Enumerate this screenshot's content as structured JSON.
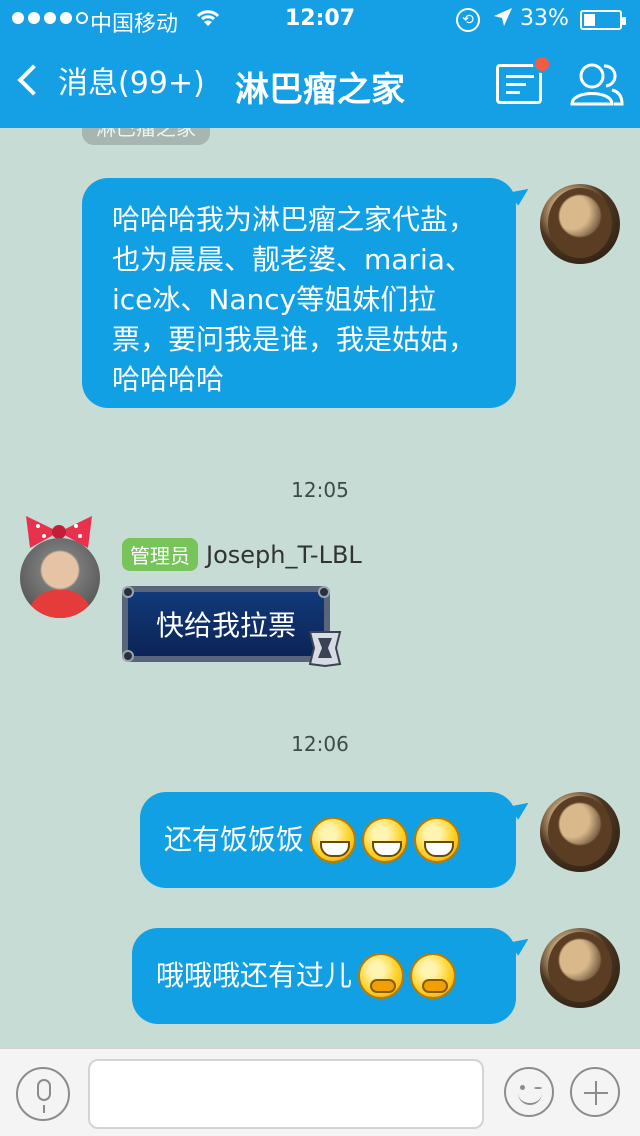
{
  "status_bar": {
    "carrier": "中国移动",
    "time": "12:07",
    "battery_percent_text": "33%",
    "battery_level": 0.33
  },
  "nav": {
    "back_label": "消息(99+)",
    "title": "淋巴瘤之家"
  },
  "chat": {
    "clipped_tag": "淋巴瘤之家",
    "timestamps": [
      "12:05",
      "12:06"
    ],
    "messages": [
      {
        "sender": "me",
        "text": "哈哈哈我为淋巴瘤之家代盐，也为晨晨、靓老婆、maria、ice冰、Nancy等姐妹们拉票，要问我是谁，我是姑姑，哈哈哈哈"
      },
      {
        "sender": "admin",
        "role": "管理员",
        "name": "Joseph_T-LBL",
        "text": "快给我拉票"
      },
      {
        "sender": "me",
        "text": "还有饭饭饭",
        "emojis": [
          "grin",
          "grin",
          "grin"
        ]
      },
      {
        "sender": "me",
        "text": "哦哦哦还有过儿",
        "emojis": [
          "shy",
          "shy"
        ]
      }
    ]
  },
  "input_bar": {
    "placeholder": ""
  }
}
